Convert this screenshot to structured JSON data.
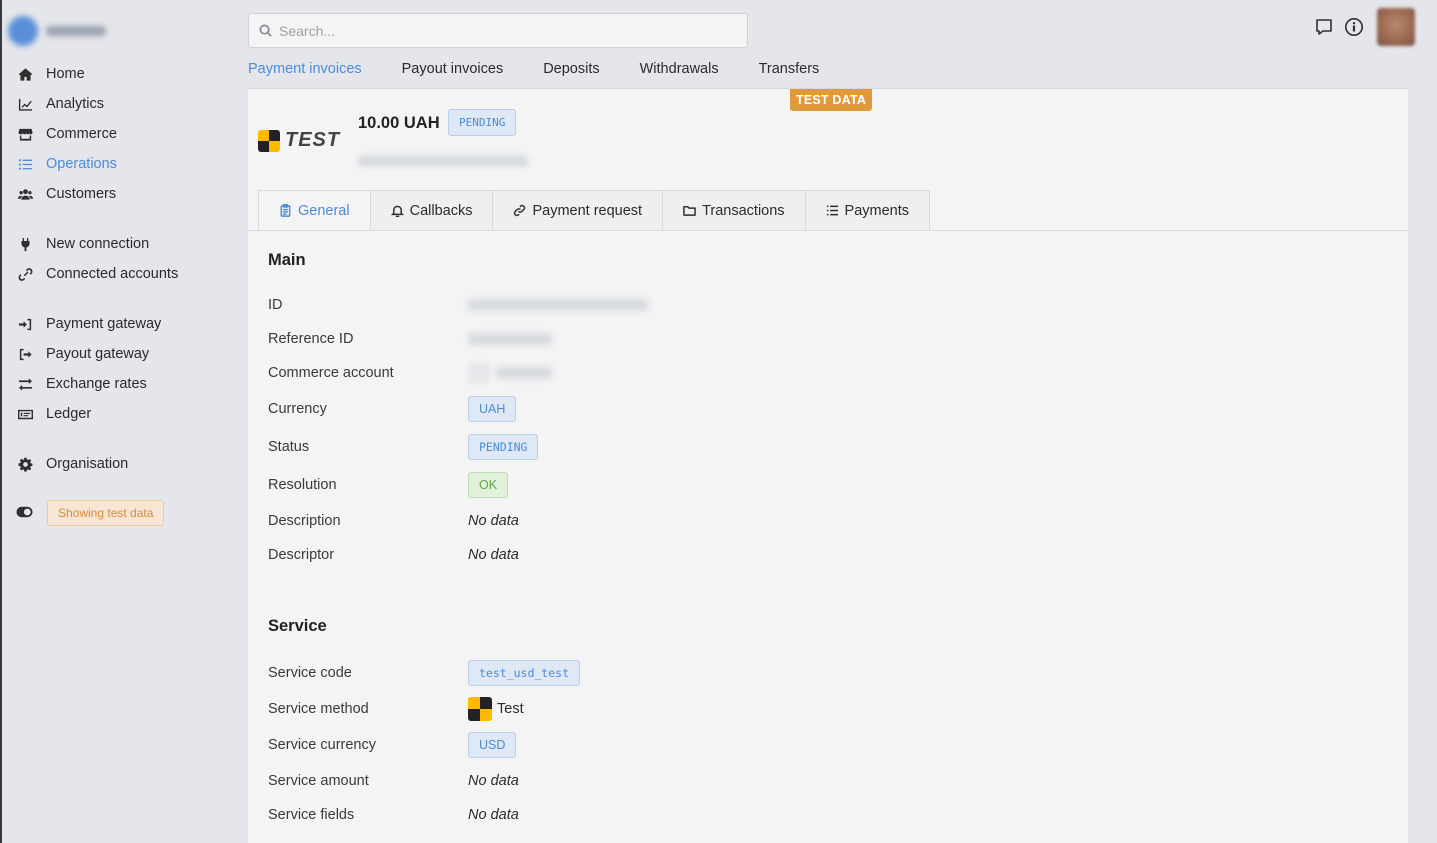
{
  "search": {
    "placeholder": "Search..."
  },
  "sidebar": {
    "items": [
      {
        "label": "Home",
        "icon": "home-icon"
      },
      {
        "label": "Analytics",
        "icon": "chart-line-icon"
      },
      {
        "label": "Commerce",
        "icon": "store-icon"
      },
      {
        "label": "Operations",
        "icon": "list-icon",
        "active": true
      },
      {
        "label": "Customers",
        "icon": "users-icon"
      },
      {
        "label": "New connection",
        "icon": "plug-icon"
      },
      {
        "label": "Connected accounts",
        "icon": "link-icon"
      },
      {
        "label": "Payment gateway",
        "icon": "sign-in-icon"
      },
      {
        "label": "Payout gateway",
        "icon": "sign-out-icon"
      },
      {
        "label": "Exchange rates",
        "icon": "exchange-icon"
      },
      {
        "label": "Ledger",
        "icon": "money-bill-icon"
      },
      {
        "label": "Organisation",
        "icon": "gear-icon"
      }
    ],
    "test_toggle_label": "Showing test data"
  },
  "top_tabs": [
    {
      "label": "Payment invoices",
      "active": true
    },
    {
      "label": "Payout invoices"
    },
    {
      "label": "Deposits"
    },
    {
      "label": "Withdrawals"
    },
    {
      "label": "Transfers"
    }
  ],
  "test_data_label": "TEST DATA",
  "invoice": {
    "logo_text": "TEST",
    "amount": "10.00 UAH",
    "status": "PENDING"
  },
  "detail_tabs": [
    {
      "label": "General",
      "icon": "clipboard-icon",
      "active": true
    },
    {
      "label": "Callbacks",
      "icon": "bell-icon"
    },
    {
      "label": "Payment request",
      "icon": "link-icon"
    },
    {
      "label": "Transactions",
      "icon": "folder-icon"
    },
    {
      "label": "Payments",
      "icon": "list-icon"
    }
  ],
  "main": {
    "title": "Main",
    "labels": {
      "id": "ID",
      "reference_id": "Reference ID",
      "commerce_account": "Commerce account",
      "currency": "Currency",
      "status": "Status",
      "resolution": "Resolution",
      "description": "Description",
      "descriptor": "Descriptor"
    },
    "values": {
      "currency": "UAH",
      "status": "PENDING",
      "resolution": "OK",
      "description": "No data",
      "descriptor": "No data"
    }
  },
  "service": {
    "title": "Service",
    "labels": {
      "code": "Service code",
      "method": "Service method",
      "currency": "Service currency",
      "amount": "Service amount",
      "fields": "Service fields"
    },
    "values": {
      "code": "test_usd_test",
      "method": "Test",
      "currency": "USD",
      "amount": "No data",
      "fields": "No data"
    }
  },
  "colors": {
    "accent": "#4b8bd8",
    "test_orange": "#e09a3a",
    "ok_green": "#5ea74c"
  }
}
